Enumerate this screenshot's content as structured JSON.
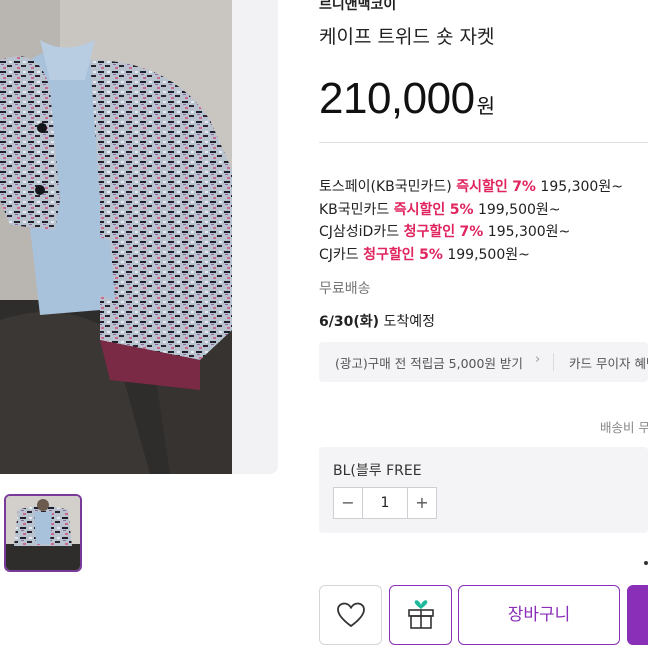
{
  "product": {
    "brand": "르니앤맥코이",
    "title": "케이프 트위드 숏 자켓",
    "price": "210,000",
    "price_unit": "원"
  },
  "card_discounts": [
    {
      "card": "토스페이(KB국민카드)",
      "type": "즉시할인",
      "rate": "7%",
      "price": "195,300원~"
    },
    {
      "card": "KB국민카드",
      "type": "즉시할인",
      "rate": "5%",
      "price": "199,500원~"
    },
    {
      "card": "CJ삼성iD카드",
      "type": "청구할인",
      "rate": "7%",
      "price": "195,300원~"
    },
    {
      "card": "CJ카드",
      "type": "청구할인",
      "rate": "5%",
      "price": "199,500원~"
    }
  ],
  "delivery": {
    "free_shipping": "무료배송",
    "arrival_date": "6/30(화)",
    "arrival_suffix": "도착예정",
    "fee_text": "배송비 무"
  },
  "promos": [
    {
      "label": "(광고)구매 전 적립금 5,000원 받기"
    },
    {
      "label": "카드 무이자 혜택"
    }
  ],
  "option": {
    "label": "BL(블루 FREE",
    "quantity": "1",
    "minus": "−",
    "plus": "+"
  },
  "actions": {
    "like_icon": "heart-icon",
    "gift_icon": "gift-icon",
    "cart_label": "장바구니"
  },
  "colors": {
    "accent": "#e0245e",
    "brand_purple": "#8a2fb8",
    "panel_bg": "#f4f4f6"
  }
}
